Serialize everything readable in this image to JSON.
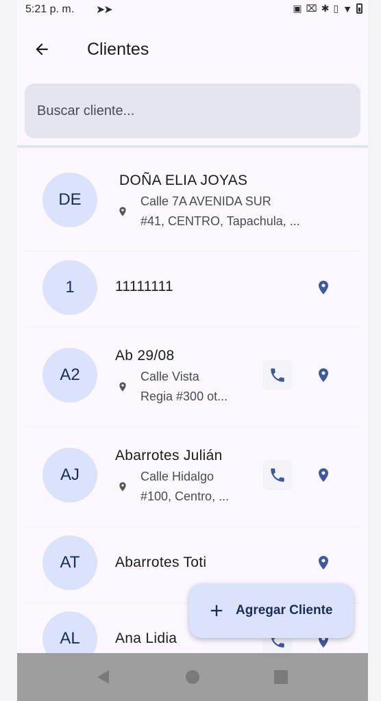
{
  "status_bar": {
    "time": "5:21 p. m."
  },
  "header": {
    "title": "Clientes"
  },
  "search": {
    "placeholder": "Buscar cliente..."
  },
  "clients": [
    {
      "initials": "DE",
      "name": "DOÑA ELIA JOYAS",
      "address_line1": "Calle 7A AVENIDA SUR",
      "address_line2": "#41, CENTRO, Tapachula, ..."
    },
    {
      "initials": "1",
      "name": "11111111"
    },
    {
      "initials": "A2",
      "name": "Ab 29/08",
      "address_line1": "Calle Vista",
      "address_line2": "Regia #300 ot..."
    },
    {
      "initials": "AJ",
      "name": "Abarrotes Julián",
      "address_line1": "Calle Hidalgo",
      "address_line2": "#100, Centro, ..."
    },
    {
      "initials": "AT",
      "name": "Abarrotes Toti"
    },
    {
      "initials": "AL",
      "name": "Ana Lidia"
    }
  ],
  "fab": {
    "label": "Agregar Cliente"
  },
  "colors": {
    "accent": "#3f5a9a",
    "avatar_bg": "#dbe2fb",
    "avatar_text": "#1a2c57"
  }
}
